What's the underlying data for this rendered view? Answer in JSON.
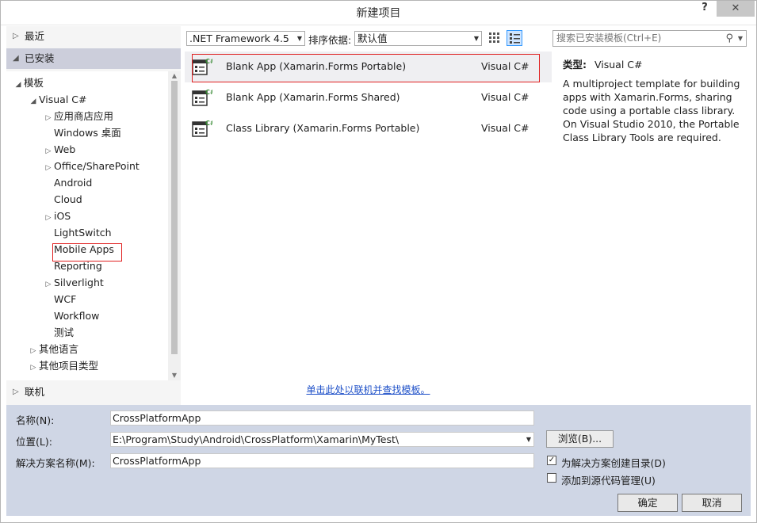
{
  "window": {
    "title": "新建项目",
    "help": "?",
    "close": "✕"
  },
  "left": {
    "recent": "最近",
    "installed": "已安装",
    "online": "联机",
    "tree": [
      {
        "label": "模板",
        "expander": "◢",
        "level": 0
      },
      {
        "label": "Visual C#",
        "expander": "◢",
        "level": 1
      },
      {
        "label": "应用商店应用",
        "expander": "▷",
        "level": 2
      },
      {
        "label": "Windows 桌面",
        "expander": "",
        "level": 2
      },
      {
        "label": "Web",
        "expander": "▷",
        "level": 2
      },
      {
        "label": "Office/SharePoint",
        "expander": "▷",
        "level": 2
      },
      {
        "label": "Android",
        "expander": "",
        "level": 2
      },
      {
        "label": "Cloud",
        "expander": "",
        "level": 2
      },
      {
        "label": "iOS",
        "expander": "▷",
        "level": 2
      },
      {
        "label": "LightSwitch",
        "expander": "",
        "level": 2
      },
      {
        "label": "Mobile Apps",
        "expander": "",
        "level": 2
      },
      {
        "label": "Reporting",
        "expander": "",
        "level": 2
      },
      {
        "label": "Silverlight",
        "expander": "▷",
        "level": 2
      },
      {
        "label": "WCF",
        "expander": "",
        "level": 2
      },
      {
        "label": "Workflow",
        "expander": "",
        "level": 2
      },
      {
        "label": "测试",
        "expander": "",
        "level": 2
      },
      {
        "label": "其他语言",
        "expander": "▷",
        "level": 1
      },
      {
        "label": "其他项目类型",
        "expander": "▷",
        "level": 1
      }
    ]
  },
  "toolbar": {
    "framework": ".NET Framework 4.5",
    "sort_label": "排序依据:",
    "sort_value": "默认值",
    "search_placeholder": "搜索已安装模板(Ctrl+E)"
  },
  "templates": [
    {
      "name": "Blank App (Xamarin.Forms Portable)",
      "lang": "Visual C#",
      "selected": true
    },
    {
      "name": "Blank App (Xamarin.Forms Shared)",
      "lang": "Visual C#",
      "selected": false
    },
    {
      "name": "Class Library (Xamarin.Forms Portable)",
      "lang": "Visual C#",
      "selected": false
    }
  ],
  "online_link": "单击此处以联机并查找模板。",
  "details": {
    "type_label": "类型:",
    "type_value": "Visual C#",
    "description": "A multiproject template for building apps with Xamarin.Forms, sharing code using a portable class library. On Visual Studio 2010, the Portable Class Library Tools are required."
  },
  "form": {
    "name_label": "名称(N):",
    "name_value": "CrossPlatformApp",
    "location_label": "位置(L):",
    "location_value": "E:\\Program\\Study\\Android\\CrossPlatform\\Xamarin\\MyTest\\",
    "solution_label": "解决方案名称(M):",
    "solution_value": "CrossPlatformApp",
    "browse": "浏览(B)...",
    "create_dir_label": "为解决方案创建目录(D)",
    "create_dir_checked": true,
    "add_scm_label": "添加到源代码管理(U)",
    "add_scm_checked": false,
    "ok": "确定",
    "cancel": "取消"
  },
  "colors": {
    "highlight_border": "#e02020",
    "installed_bg": "#cccedb",
    "bottom_bg": "#cfd6e5",
    "link": "#1e50c8"
  }
}
